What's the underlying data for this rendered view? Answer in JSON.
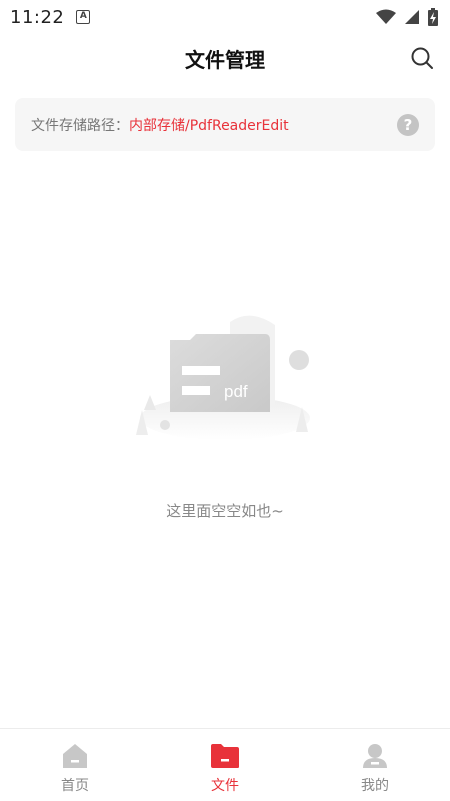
{
  "status_bar": {
    "time": "11:22",
    "notification_icon": "A",
    "icons": [
      "wifi-icon",
      "signal-icon",
      "battery-icon"
    ]
  },
  "header": {
    "title": "文件管理",
    "search_icon": "search-icon"
  },
  "path_card": {
    "label": "文件存储路径：",
    "value": "内部存储/PdfReaderEdit",
    "help_icon": "?"
  },
  "empty_state": {
    "illustration_text": "pdf",
    "message": "这里面空空如也~"
  },
  "bottom_nav": {
    "items": [
      {
        "label": "首页",
        "icon": "home-icon",
        "active": false
      },
      {
        "label": "文件",
        "icon": "folder-icon",
        "active": true
      },
      {
        "label": "我的",
        "icon": "user-icon",
        "active": false
      }
    ]
  },
  "colors": {
    "accent": "#e8323a",
    "inactive": "#888888",
    "card_bg": "#f6f6f6"
  }
}
